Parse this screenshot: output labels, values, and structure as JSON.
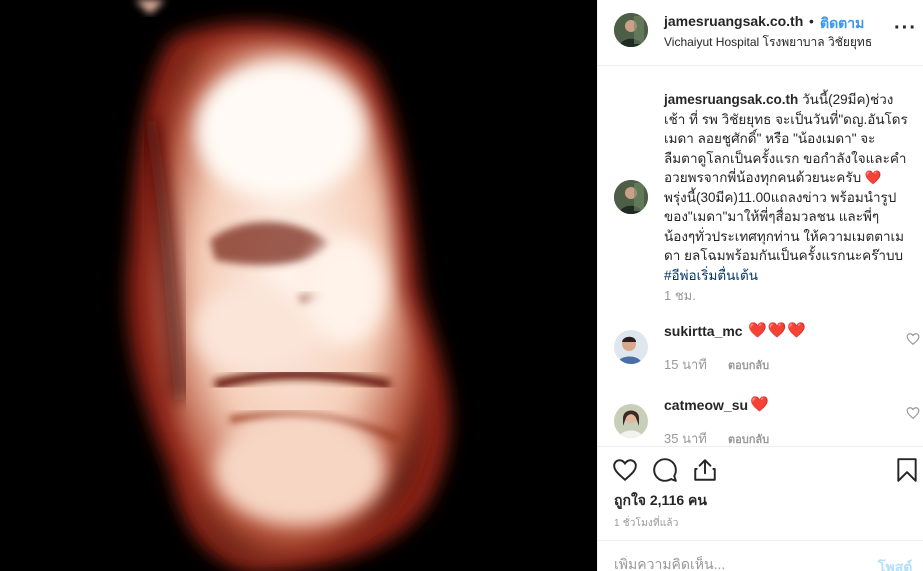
{
  "post": {
    "username": "jamesruangsak.co.th",
    "separator": "•",
    "follow_label": "ติดตาม",
    "location": "Vichaiyut Hospital โรงพยาบาล วิชัยยุทธ",
    "more_icon": "more-horizontal-icon"
  },
  "caption": {
    "username": "jamesruangsak.co.th",
    "text_part1": " วันนี้(29มีค)ช่วงเช้า ที่ รพ วิชัยยุทธ จะเป็นวันที่\"ดญ.อันโดรเมดา ลอยชูศักดิ์\" หรือ \"น้องเมดา\" จะลืมตาดูโลกเป็นครั้งแรก ขอกำลังใจและคำอวยพรจากพี่น้องทุกคนด้วยนะครับ ",
    "heart": "❤️",
    "text_part2": " พรุ่งนี้(30มีค)11.00แถลงข่าว พร้อมนำรูปของ\"เมดา\"มาให้พี่ๆสื่อมวลชน และพี่ๆน้องๆทั่วประเทศทุกท่าน ให้ความเมตตาเมดา ยลโฉมพร้อมกันเป็นครั้งแรกนะคร๊าบบ",
    "hashtag": "#อีพ่อเริ่มตื่นเต้น",
    "time": "1 ชม."
  },
  "comments": [
    {
      "username": "sukirtta_mc",
      "text": "❤️❤️❤️",
      "age": "15 นาที",
      "reply_label": "ตอบกลับ"
    },
    {
      "username": "catmeow_su",
      "text": "❤️",
      "age": "35 นาที",
      "reply_label": "ตอบกลับ"
    }
  ],
  "actions": {
    "like_icon": "heart-outline-icon",
    "comment_icon": "comment-bubble-icon",
    "share_icon": "share-icon",
    "save_icon": "bookmark-icon"
  },
  "likes_text": "ถูกใจ 2,116 คน",
  "posted_ago": "1 ชั่วโมงที่แล้ว",
  "add_comment": {
    "placeholder": "เพิ่มความคิดเห็น...",
    "post_label": "โพสต์"
  },
  "colors": {
    "accent": "#3897f0",
    "heart": "#ed4956",
    "hashtag": "#003569",
    "muted": "#999999"
  }
}
